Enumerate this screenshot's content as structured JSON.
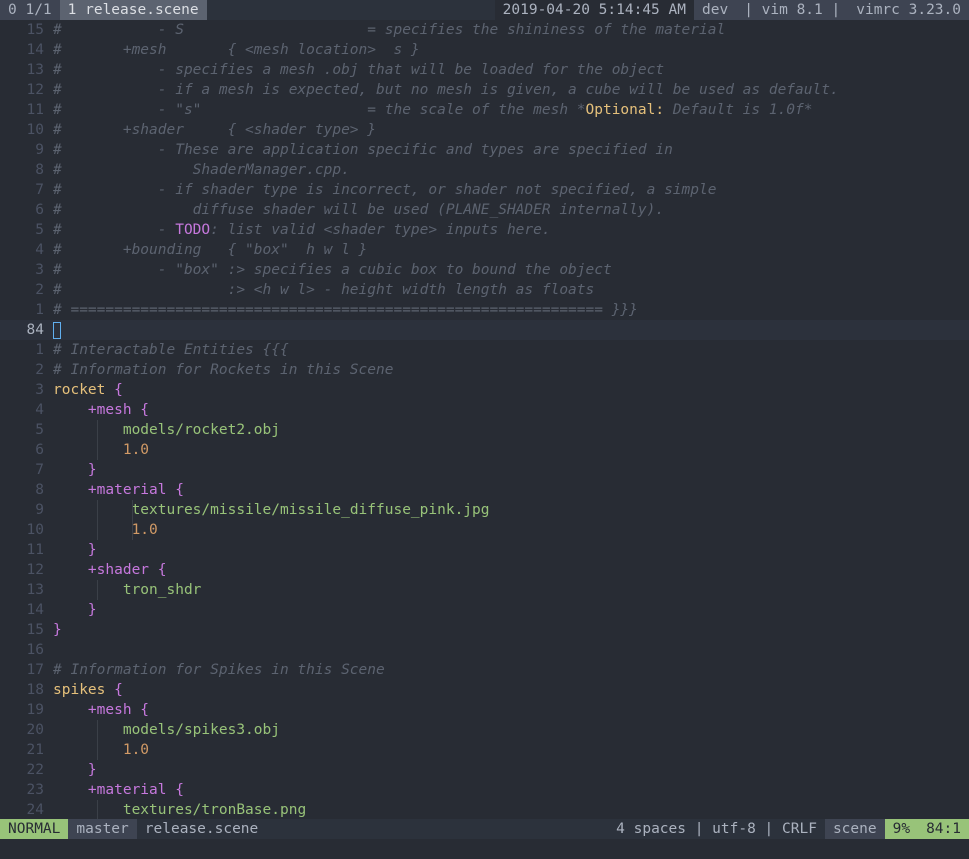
{
  "tabline": {
    "tab_count": "0 1/1",
    "active_tab": "1 release.scene",
    "datetime": "2019-04-20 5:14:45 AM",
    "branch": "dev",
    "vim_version": "vim 8.1",
    "vimrc_version": "vimrc 3.23.0"
  },
  "lines": {
    "l15": {
      "nr": "15",
      "text": "#           - S                     = specifies the shininess of the material"
    },
    "l14": {
      "nr": "14",
      "text": "#       +mesh       { <mesh location>  s }"
    },
    "l13": {
      "nr": "13",
      "text": "#           - specifies a mesh .obj that will be loaded for the object"
    },
    "l12": {
      "nr": "12",
      "text": "#           - if a mesh is expected, but no mesh is given, a cube will be used as default."
    },
    "l11": {
      "nr": "11",
      "pre": "#           - \"s\"                   = the scale of the mesh *",
      "opt": "Optional:",
      "post": " Default is 1.0f*"
    },
    "l10": {
      "nr": "10",
      "text": "#       +shader     { <shader type> }"
    },
    "l9": {
      "nr": "9",
      "text": "#           - These are application specific and types are specified in"
    },
    "l8": {
      "nr": "8",
      "text": "#               ShaderManager.cpp."
    },
    "l7": {
      "nr": "7",
      "text": "#           - if shader type is incorrect, or shader not specified, a simple"
    },
    "l6": {
      "nr": "6",
      "text": "#               diffuse shader will be used (PLANE_SHADER internally)."
    },
    "l5": {
      "nr": "5",
      "pre": "#           - ",
      "todo": "TODO",
      "post": ": list valid <shader type> inputs here."
    },
    "l4": {
      "nr": "4",
      "text": "#       +bounding   { \"box\"  h w l }"
    },
    "l3": {
      "nr": "3",
      "text": "#           - \"box\" :> specifies a cubic box to bound the object"
    },
    "l2": {
      "nr": "2",
      "text": "#                   :> <h w l> - height width length as floats"
    },
    "l1": {
      "nr": "1",
      "text": "# ============================================================= }}}"
    },
    "cur": {
      "nr": "84"
    },
    "a1": {
      "nr": "1",
      "text": "# Interactable Entities {{{"
    },
    "a2": {
      "nr": "2",
      "text": "# Information for Rockets in this Scene"
    },
    "a3": {
      "nr": "3",
      "id": "rocket",
      "br": " {"
    },
    "a4": {
      "nr": "4",
      "kw": "+mesh",
      "br": " {"
    },
    "a5": {
      "nr": "5",
      "str": "models/rocket2.obj"
    },
    "a6": {
      "nr": "6",
      "num": "1.0"
    },
    "a7": {
      "nr": "7",
      "br": "}"
    },
    "a8": {
      "nr": "8",
      "kw": "+material",
      "br": " {"
    },
    "a9": {
      "nr": "9",
      "str": "textures/missile/missile_diffuse_pink.jpg"
    },
    "a10": {
      "nr": "10",
      "num": "1.0"
    },
    "a11": {
      "nr": "11",
      "br": "}"
    },
    "a12": {
      "nr": "12",
      "kw": "+shader",
      "br": " {"
    },
    "a13": {
      "nr": "13",
      "str": "tron_shdr"
    },
    "a14": {
      "nr": "14",
      "br": "}"
    },
    "a15": {
      "nr": "15",
      "br": "}"
    },
    "a16": {
      "nr": "16"
    },
    "a17": {
      "nr": "17",
      "text": "# Information for Spikes in this Scene"
    },
    "a18": {
      "nr": "18",
      "id": "spikes",
      "br": " {"
    },
    "a19": {
      "nr": "19",
      "kw": "+mesh",
      "br": " {"
    },
    "a20": {
      "nr": "20",
      "str": "models/spikes3.obj"
    },
    "a21": {
      "nr": "21",
      "num": "1.0"
    },
    "a22": {
      "nr": "22",
      "br": "}"
    },
    "a23": {
      "nr": "23",
      "kw": "+material",
      "br": " {"
    },
    "a24": {
      "nr": "24",
      "str": "textures/tronBase.png"
    }
  },
  "statusline": {
    "mode": "NORMAL",
    "branch": "master",
    "filename": "release.scene",
    "info": "4 spaces | utf-8 | CRLF",
    "filetype": "scene",
    "percent": "9%",
    "position": "84:1"
  },
  "colors": {
    "background": "#282c34",
    "mode_bg": "#98c379",
    "comment": "#5c6370",
    "keyword": "#c678dd",
    "identifier": "#e5c07b",
    "string": "#98c379",
    "number": "#d19a66"
  }
}
